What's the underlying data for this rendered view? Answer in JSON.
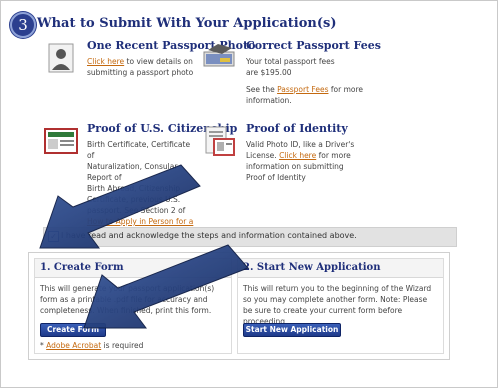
{
  "section": {
    "number": "3",
    "title": "What to Submit With Your Application(s)"
  },
  "items": [
    {
      "title": "One Recent Passport Photo",
      "icon": "portrait-photo-icon",
      "link": "Click here",
      "text": "to view details on submitting a passport photo"
    },
    {
      "title": "Correct Passport Fees",
      "icon": "money-payment-icon",
      "line1": "Your total passport fees",
      "line2": "are $195.00",
      "see": "See the",
      "link": "Passport Fees",
      "after": "for more information."
    },
    {
      "title": "Proof of U.S. Citizenship",
      "icon": "birth-certificate-icon",
      "text1": "Birth Certificate, Certificate of",
      "text2": "Naturalization, Consular Report of",
      "text3": "Birth Abroad, Citizenship",
      "text4": "Certificate, previous U.S.",
      "text5": "passport. See Section 2 of",
      "link": "How to Apply in Person for a Passport."
    },
    {
      "title": "Proof of Identity",
      "icon": "id-card-icon",
      "text1": "Valid Photo ID, like a Driver's",
      "text2": "License.",
      "link": "Click here",
      "text3": "for more information on submitting Proof of Identity"
    }
  ],
  "acknowledge": {
    "checked": true,
    "label": "I have read and acknowledge the steps and information contained above."
  },
  "panels": {
    "create": {
      "title": "1. Create Form",
      "text": "This will generate your passport application(s) form as a printable .pdf file for accuracy and completeness. When finished, print this form.",
      "button": "Create Form",
      "footnote_prefix": "*",
      "footnote_link": "Adobe Acrobat",
      "footnote_suffix": "is required"
    },
    "new": {
      "title": "2. Start New Application",
      "text": "This will return you to the beginning of the Wizard so you may complete another form. Note: Please be sure to create your current form before proceeding.",
      "button": "Start New Application"
    }
  },
  "annotation_arrows": [
    "arrow-pointing-to-checkbox",
    "arrow-pointing-to-create-form-button"
  ],
  "colors": {
    "title_blue": "#1f2f7a",
    "link_orange": "#c4690f",
    "button_blue": "#2a4a9e",
    "arrow_navy": "#1f3670"
  }
}
